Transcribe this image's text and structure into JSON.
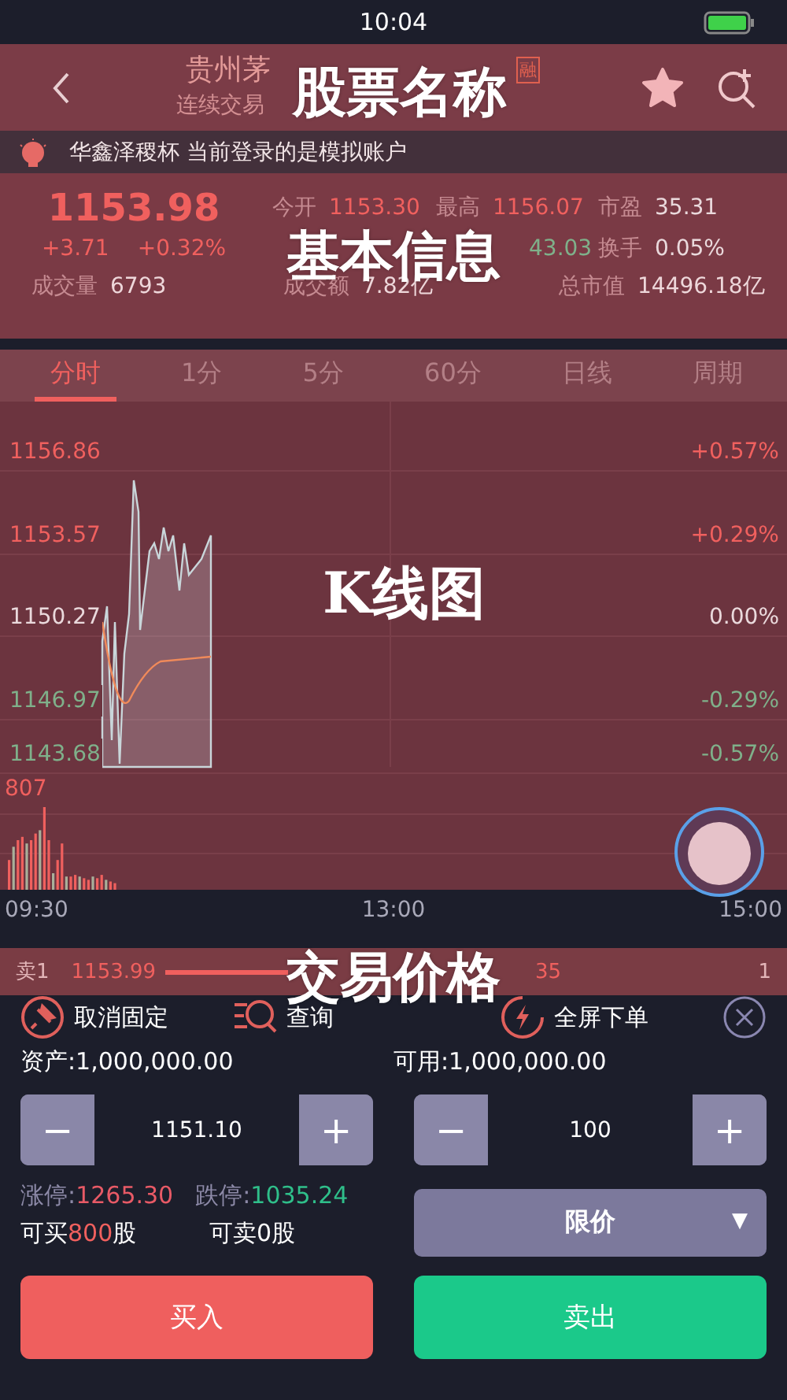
{
  "status_bar": {
    "time": "10:04"
  },
  "header": {
    "title_visible": "贵州茅",
    "badge": "融",
    "subtitle_visible": "连续交易",
    "annotation": "股票名称"
  },
  "notice": {
    "text": "华鑫泽稷杯 当前登录的是模拟账户"
  },
  "quote": {
    "price": "1153.98",
    "change": "+3.71",
    "change_pct": "+0.32%",
    "annotation": "基本信息",
    "row1": [
      {
        "label": "今开",
        "value": "1153.30",
        "color": "#f0605e"
      },
      {
        "label": "最高",
        "value": "1156.07",
        "color": "#f0605e"
      },
      {
        "label": "市盈",
        "value": "35.31",
        "color": "#ead9dc"
      }
    ],
    "row2_fragment": {
      "value": "43.03",
      "color": "#7fb08a"
    },
    "row2": [
      {
        "label": "换手",
        "value": "0.05%",
        "color": "#ead9dc"
      }
    ],
    "row3": [
      {
        "label": "成交量",
        "value": "6793"
      },
      {
        "label": "成交额",
        "value": "7.82亿"
      },
      {
        "label": "总市值",
        "value": "14496.18亿"
      }
    ]
  },
  "chart": {
    "annotation": "K线图",
    "tabs": [
      {
        "label": "分时",
        "selected": true
      },
      {
        "label": "1分",
        "selected": false
      },
      {
        "label": "5分",
        "selected": false
      },
      {
        "label": "60分",
        "selected": false
      },
      {
        "label": "日线",
        "selected": false
      },
      {
        "label": "周期",
        "selected": false
      }
    ],
    "left_labels": [
      {
        "text": "1156.86",
        "color": "#f0605e"
      },
      {
        "text": "1153.57",
        "color": "#f0605e"
      },
      {
        "text": "1150.27",
        "color": "#ead9dc"
      },
      {
        "text": "1146.97",
        "color": "#7fb08a"
      },
      {
        "text": "1143.68",
        "color": "#7fb08a"
      }
    ],
    "right_labels": [
      {
        "text": "+0.57%",
        "color": "#f0605e"
      },
      {
        "text": "+0.29%",
        "color": "#f0605e"
      },
      {
        "text": "0.00%",
        "color": "#ead9dc"
      },
      {
        "text": "-0.29%",
        "color": "#7fb08a"
      },
      {
        "text": "-0.57%",
        "color": "#7fb08a"
      }
    ],
    "volume_label": "807",
    "time_labels": [
      "09:30",
      "13:00",
      "15:00"
    ]
  },
  "sell_row": {
    "label": "卖1",
    "price": "1153.99",
    "fragment": "35",
    "count": "1",
    "annotation": "交易价格"
  },
  "toolbar": [
    {
      "kind": "pin",
      "label": "取消固定"
    },
    {
      "kind": "query",
      "label": "查询"
    },
    {
      "kind": "bolt",
      "label": "全屏下单"
    },
    {
      "kind": "close"
    }
  ],
  "assets": {
    "total": "资产:1,000,000.00",
    "available": "可用:1,000,000.00"
  },
  "price_stepper": {
    "minus": "−",
    "value": "1151.10",
    "plus": "+"
  },
  "qty_stepper": {
    "minus": "−",
    "value": "100",
    "plus": "+"
  },
  "limits": [
    {
      "label": "涨停:",
      "value": "1265.30",
      "color": "#e85a66"
    },
    {
      "label": "跌停:",
      "value": "1035.24",
      "color": "#2fbf8a"
    }
  ],
  "order_type": {
    "value": "限价",
    "caret": "▼"
  },
  "can_buy": {
    "prefix": "可买",
    "amount": "800",
    "suffix": "股"
  },
  "can_sell": "可卖0股",
  "buttons": [
    {
      "kind": "buy",
      "label": "买入"
    },
    {
      "kind": "sell",
      "label": "卖出"
    }
  ]
}
